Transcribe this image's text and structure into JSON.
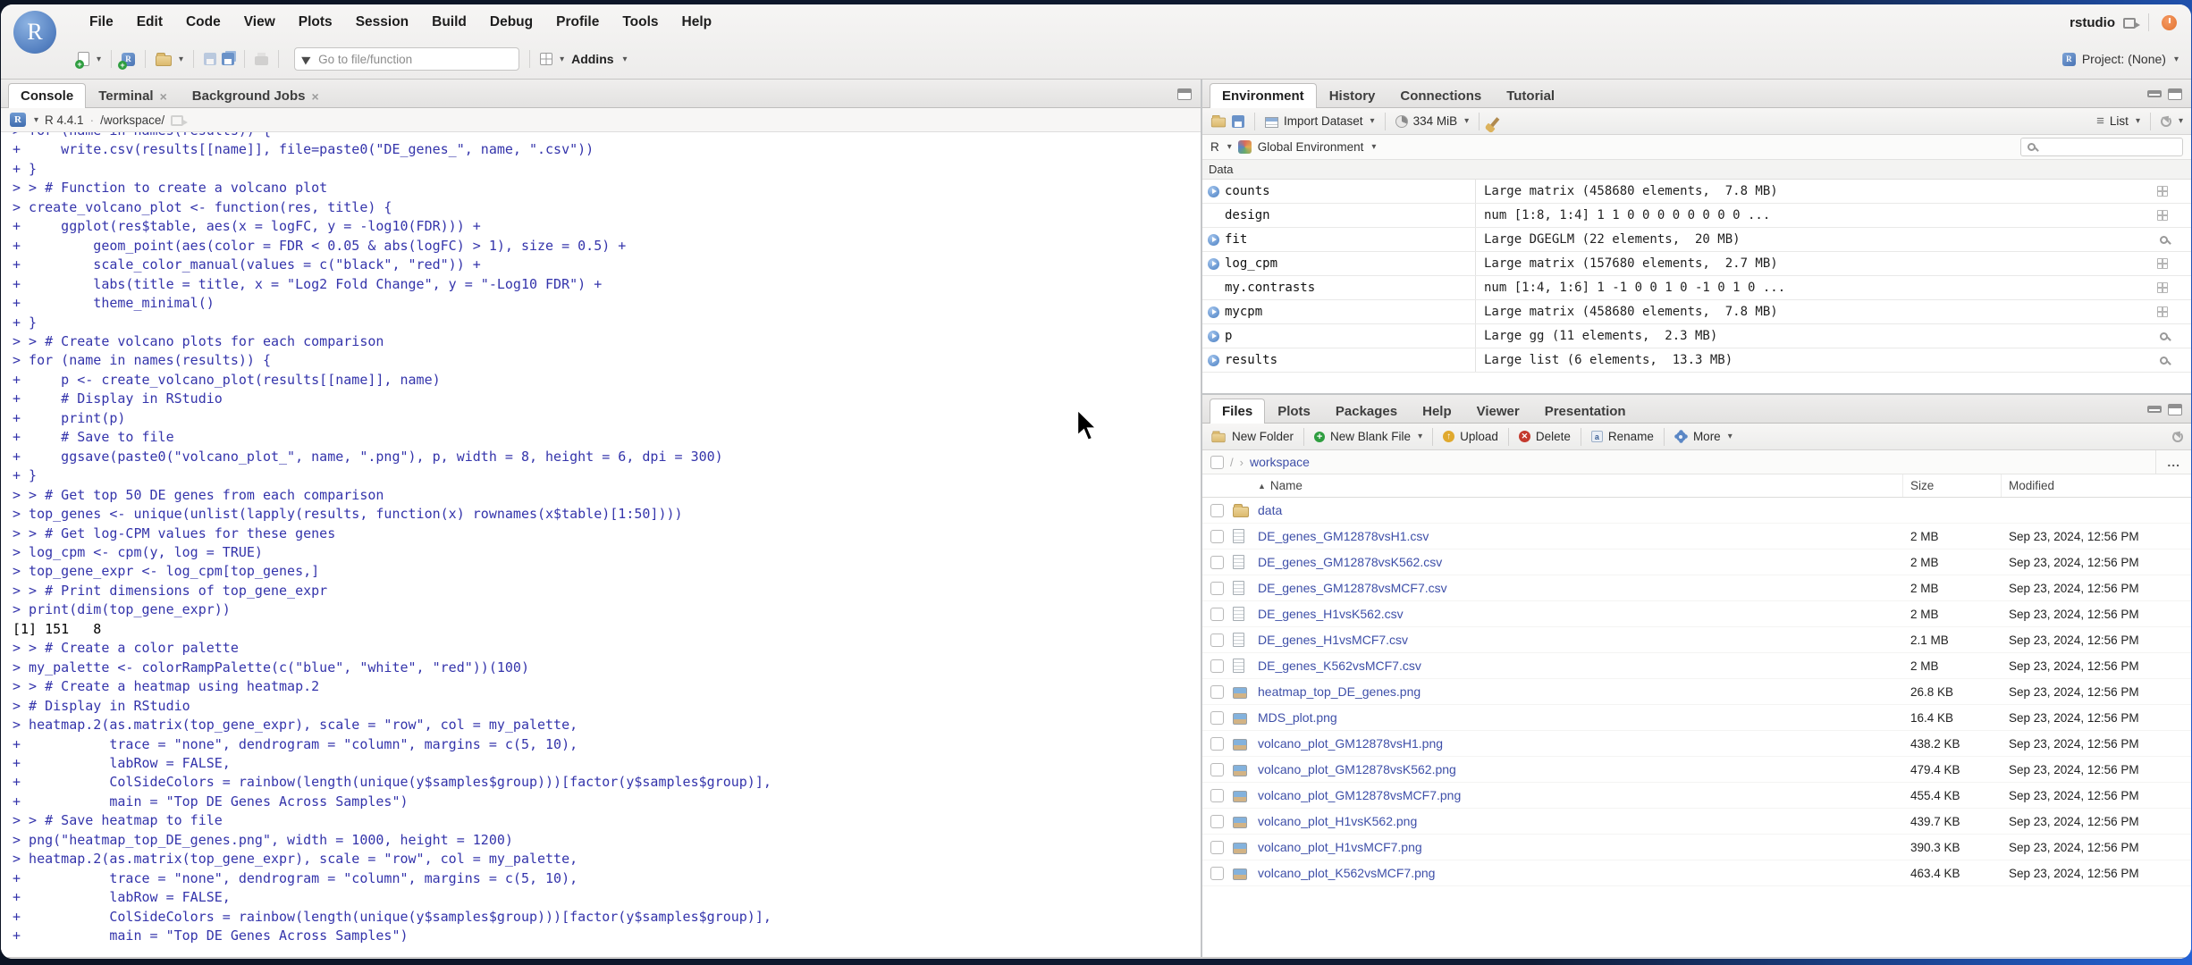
{
  "window": {
    "menu": [
      "File",
      "Edit",
      "Code",
      "View",
      "Plots",
      "Session",
      "Build",
      "Debug",
      "Profile",
      "Tools",
      "Help"
    ],
    "user": "rstudio",
    "project": "Project: (None)",
    "toolbar": {
      "goto_placeholder": "Go to file/function",
      "addins_label": "Addins"
    }
  },
  "console": {
    "tabs": [
      {
        "label": "Console",
        "active": true,
        "closable": false
      },
      {
        "label": "Terminal",
        "active": false,
        "closable": true
      },
      {
        "label": "Background Jobs",
        "active": false,
        "closable": true
      }
    ],
    "header": {
      "r_version": "R 4.4.1",
      "separator": "·",
      "cwd": "/workspace/"
    },
    "lines": [
      {
        "text": "> for (name in names(results)) {"
      },
      {
        "text": "+     write.csv(results[[name]], file=paste0(\"DE_genes_\", name, \".csv\"))"
      },
      {
        "text": "+ }"
      },
      {
        "text": "> > # Function to create a volcano plot"
      },
      {
        "text": "> create_volcano_plot <- function(res, title) {"
      },
      {
        "text": "+     ggplot(res$table, aes(x = logFC, y = -log10(FDR))) +"
      },
      {
        "text": "+         geom_point(aes(color = FDR < 0.05 & abs(logFC) > 1), size = 0.5) +"
      },
      {
        "text": "+         scale_color_manual(values = c(\"black\", \"red\")) +"
      },
      {
        "text": "+         labs(title = title, x = \"Log2 Fold Change\", y = \"-Log10 FDR\") +"
      },
      {
        "text": "+         theme_minimal()"
      },
      {
        "text": "+ }"
      },
      {
        "text": "> > # Create volcano plots for each comparison"
      },
      {
        "text": "> for (name in names(results)) {"
      },
      {
        "text": "+     p <- create_volcano_plot(results[[name]], name)"
      },
      {
        "text": "+     # Display in RStudio"
      },
      {
        "text": "+     print(p)"
      },
      {
        "text": "+     # Save to file"
      },
      {
        "text": "+     ggsave(paste0(\"volcano_plot_\", name, \".png\"), p, width = 8, height = 6, dpi = 300)"
      },
      {
        "text": "+ }"
      },
      {
        "text": "> > # Get top 50 DE genes from each comparison"
      },
      {
        "text": "> top_genes <- unique(unlist(lapply(results, function(x) rownames(x$table)[1:50])))"
      },
      {
        "text": "> > # Get log-CPM values for these genes"
      },
      {
        "text": "> log_cpm <- cpm(y, log = TRUE)"
      },
      {
        "text": "> top_gene_expr <- log_cpm[top_genes,]"
      },
      {
        "text": "> > # Print dimensions of top_gene_expr"
      },
      {
        "text": "> print(dim(top_gene_expr))"
      },
      {
        "text": "[1] 151   8",
        "output": true
      },
      {
        "text": "> > # Create a color palette"
      },
      {
        "text": "> my_palette <- colorRampPalette(c(\"blue\", \"white\", \"red\"))(100)"
      },
      {
        "text": "> > # Create a heatmap using heatmap.2"
      },
      {
        "text": "> # Display in RStudio"
      },
      {
        "text": "> heatmap.2(as.matrix(top_gene_expr), scale = \"row\", col = my_palette,"
      },
      {
        "text": "+           trace = \"none\", dendrogram = \"column\", margins = c(5, 10),"
      },
      {
        "text": "+           labRow = FALSE,"
      },
      {
        "text": "+           ColSideColors = rainbow(length(unique(y$samples$group)))[factor(y$samples$group)],"
      },
      {
        "text": "+           main = \"Top DE Genes Across Samples\")"
      },
      {
        "text": "> > # Save heatmap to file"
      },
      {
        "text": "> png(\"heatmap_top_DE_genes.png\", width = 1000, height = 1200)"
      },
      {
        "text": "> heatmap.2(as.matrix(top_gene_expr), scale = \"row\", col = my_palette,"
      },
      {
        "text": "+           trace = \"none\", dendrogram = \"column\", margins = c(5, 10),"
      },
      {
        "text": "+           labRow = FALSE,"
      },
      {
        "text": "+           ColSideColors = rainbow(length(unique(y$samples$group)))[factor(y$samples$group)],"
      },
      {
        "text": "+           main = \"Top DE Genes Across Samples\")"
      }
    ]
  },
  "environment": {
    "tabs": [
      {
        "label": "Environment",
        "active": true
      },
      {
        "label": "History",
        "active": false
      },
      {
        "label": "Connections",
        "active": false
      },
      {
        "label": "Tutorial",
        "active": false
      }
    ],
    "toolbar": {
      "import_label": "Import Dataset",
      "memory": "334 MiB",
      "list_label": "List"
    },
    "scope": {
      "lang": "R",
      "env_label": "Global Environment"
    },
    "section_label": "Data",
    "items": [
      {
        "name": "counts",
        "value": "Large matrix (458680 elements,  7.8 MB)",
        "expandable": true,
        "action": "grid"
      },
      {
        "name": "design",
        "value": "num [1:8, 1:4] 1 1 0 0 0 0 0 0 0 0 ...",
        "expandable": false,
        "action": "grid"
      },
      {
        "name": "fit",
        "value": "Large DGEGLM (22 elements,  20 MB)",
        "expandable": true,
        "action": "search"
      },
      {
        "name": "log_cpm",
        "value": "Large matrix (157680 elements,  2.7 MB)",
        "expandable": true,
        "action": "grid"
      },
      {
        "name": "my.contrasts",
        "value": "num [1:4, 1:6] 1 -1 0 0 1 0 -1 0 1 0 ...",
        "expandable": false,
        "action": "grid"
      },
      {
        "name": "mycpm",
        "value": "Large matrix (458680 elements,  7.8 MB)",
        "expandable": true,
        "action": "grid"
      },
      {
        "name": "p",
        "value": "Large gg (11 elements,  2.3 MB)",
        "expandable": true,
        "action": "search"
      },
      {
        "name": "results",
        "value": "Large list (6 elements,  13.3 MB)",
        "expandable": true,
        "action": "search"
      }
    ]
  },
  "files": {
    "tabs": [
      {
        "label": "Files",
        "active": true
      },
      {
        "label": "Plots",
        "active": false
      },
      {
        "label": "Packages",
        "active": false
      },
      {
        "label": "Help",
        "active": false
      },
      {
        "label": "Viewer",
        "active": false
      },
      {
        "label": "Presentation",
        "active": false
      }
    ],
    "toolbar": {
      "new_folder": "New Folder",
      "new_blank_file": "New Blank File",
      "upload": "Upload",
      "delete": "Delete",
      "rename": "Rename",
      "more": "More"
    },
    "breadcrumb": {
      "root": "/",
      "folder": "workspace",
      "more": "..."
    },
    "columns": [
      "Name",
      "Size",
      "Modified"
    ],
    "rows": [
      {
        "name": "data",
        "type": "folder",
        "size": "",
        "modified": ""
      },
      {
        "name": "DE_genes_GM12878vsH1.csv",
        "type": "csv",
        "size": "2 MB",
        "modified": "Sep 23, 2024, 12:56 PM"
      },
      {
        "name": "DE_genes_GM12878vsK562.csv",
        "type": "csv",
        "size": "2 MB",
        "modified": "Sep 23, 2024, 12:56 PM"
      },
      {
        "name": "DE_genes_GM12878vsMCF7.csv",
        "type": "csv",
        "size": "2 MB",
        "modified": "Sep 23, 2024, 12:56 PM"
      },
      {
        "name": "DE_genes_H1vsK562.csv",
        "type": "csv",
        "size": "2 MB",
        "modified": "Sep 23, 2024, 12:56 PM"
      },
      {
        "name": "DE_genes_H1vsMCF7.csv",
        "type": "csv",
        "size": "2.1 MB",
        "modified": "Sep 23, 2024, 12:56 PM"
      },
      {
        "name": "DE_genes_K562vsMCF7.csv",
        "type": "csv",
        "size": "2 MB",
        "modified": "Sep 23, 2024, 12:56 PM"
      },
      {
        "name": "heatmap_top_DE_genes.png",
        "type": "png",
        "size": "26.8 KB",
        "modified": "Sep 23, 2024, 12:56 PM"
      },
      {
        "name": "MDS_plot.png",
        "type": "png",
        "size": "16.4 KB",
        "modified": "Sep 23, 2024, 12:56 PM"
      },
      {
        "name": "volcano_plot_GM12878vsH1.png",
        "type": "png",
        "size": "438.2 KB",
        "modified": "Sep 23, 2024, 12:56 PM"
      },
      {
        "name": "volcano_plot_GM12878vsK562.png",
        "type": "png",
        "size": "479.4 KB",
        "modified": "Sep 23, 2024, 12:56 PM"
      },
      {
        "name": "volcano_plot_GM12878vsMCF7.png",
        "type": "png",
        "size": "455.4 KB",
        "modified": "Sep 23, 2024, 12:56 PM"
      },
      {
        "name": "volcano_plot_H1vsK562.png",
        "type": "png",
        "size": "439.7 KB",
        "modified": "Sep 23, 2024, 12:56 PM"
      },
      {
        "name": "volcano_plot_H1vsMCF7.png",
        "type": "png",
        "size": "390.3 KB",
        "modified": "Sep 23, 2024, 12:56 PM"
      },
      {
        "name": "volcano_plot_K562vsMCF7.png",
        "type": "png",
        "size": "463.4 KB",
        "modified": "Sep 23, 2024, 12:56 PM"
      }
    ]
  },
  "colors": {
    "console_input": "#3434ab",
    "console_output": "#000000",
    "file_link": "#3e4fa8",
    "logo_blue": "#537fc0",
    "power_orange": "#e2722f"
  }
}
